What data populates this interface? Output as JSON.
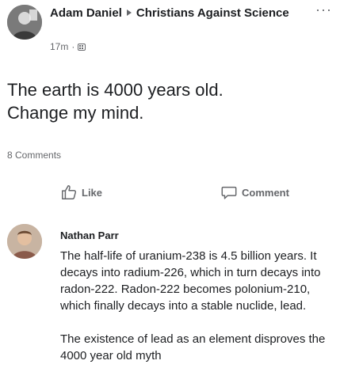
{
  "post": {
    "author": "Adam Daniel",
    "group": "Christians Against Science",
    "time": "17m",
    "separator": "·",
    "more_label": "···",
    "text_line1": "The earth is 4000 years old.",
    "text_line2": "Change my mind.",
    "comments_count": "8 Comments"
  },
  "actions": {
    "like_label": "Like",
    "comment_label": "Comment"
  },
  "comment": {
    "author": "Nathan Parr",
    "paragraph1": "The half-life of uranium-238 is 4.5 billion years. It decays into radium-226, which in turn decays into radon-222. Radon-222 becomes polonium-210, which finally decays into a stable nuclide, lead.",
    "paragraph2": "The existence of lead as an element disproves the 4000 year old myth"
  },
  "colors": {
    "text": "#1c1e21",
    "secondary": "#65676b",
    "background": "#ffffff"
  },
  "icons": [
    "group-icon",
    "more-icon",
    "like-icon",
    "comment-icon",
    "arrow-icon"
  ]
}
